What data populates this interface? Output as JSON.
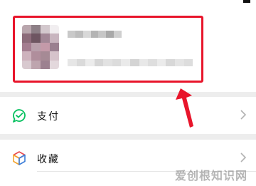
{
  "menu": {
    "pay_label": "支付",
    "favorites_label": "收藏"
  },
  "watermark": "爱创根知识网",
  "colors": {
    "highlight_red": "#e8152b",
    "pay_green": "#07c160",
    "background": "#ededed"
  },
  "icons": {
    "pay": "wallet-check-icon",
    "favorites": "cube-icon",
    "chevron": "chevron-right-icon"
  }
}
